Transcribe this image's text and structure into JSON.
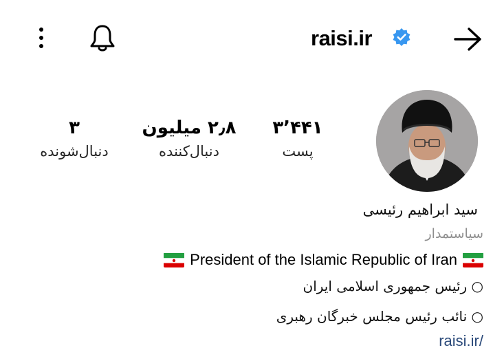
{
  "header": {
    "username": "raisi.ir",
    "verified_color": "#3897f0",
    "icons": [
      "back-arrow-icon",
      "bell-icon",
      "more-vertical-icon",
      "verified-badge-icon"
    ]
  },
  "stats": {
    "posts": {
      "value": "۳٬۴۴۱",
      "label": "پست"
    },
    "followers": {
      "value": "۲٫۸ میلیون",
      "label": "دنبال‌کننده"
    },
    "following": {
      "value": "۳",
      "label": "دنبال‌شونده"
    }
  },
  "profile": {
    "name": "سید ابراهیم رئیسی",
    "category": "سیاستمدار",
    "bio_english": "President of the Islamic Republic of Iran",
    "bio_lines": [
      "○ رئیس جمهوری اسلامی ایران",
      "○ نائب رئیس مجلس خبرگان رهبری"
    ],
    "link": "raisi.ir/"
  },
  "colors": {
    "category_gray": "#8e8e8e",
    "link_blue": "#2b4a7a",
    "flag_green": "#239f40",
    "flag_red": "#da0000"
  }
}
